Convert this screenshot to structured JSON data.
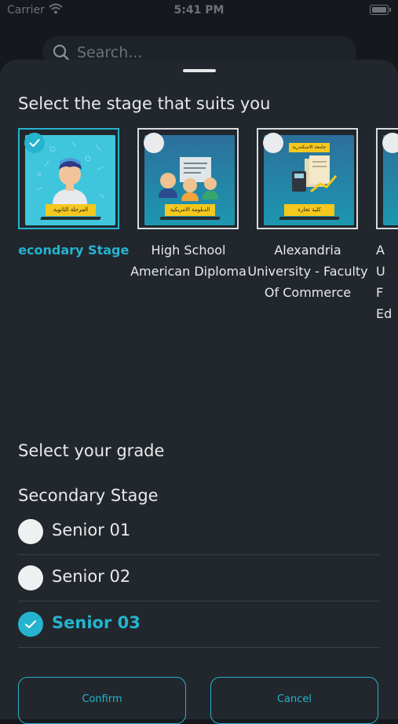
{
  "status_bar": {
    "carrier": "Carrier",
    "time": "5:41 PM"
  },
  "search": {
    "placeholder": "Search..."
  },
  "stage_section": {
    "title": "Select the stage that suits you",
    "stages": [
      {
        "label": "Secondary Stage",
        "thumb_text": "المرحلة الثانوية",
        "selected": true
      },
      {
        "label": "High School American Diploma",
        "thumb_text": "الدبلومة الامريكية",
        "selected": false
      },
      {
        "label": "Alexandria University - Faculty Of Commerce",
        "thumb_text": "كلية تجارة",
        "thumb_header": "جامعة الاسكندرية",
        "selected": false
      },
      {
        "label": "A U F Ed",
        "selected": false
      }
    ]
  },
  "grade_section": {
    "title": "Select your grade",
    "subtitle": "Secondary Stage",
    "grades": [
      {
        "label": "Senior 01",
        "selected": false
      },
      {
        "label": "Senior 02",
        "selected": false
      },
      {
        "label": "Senior 03",
        "selected": true
      }
    ]
  },
  "actions": {
    "confirm": "Confirm",
    "cancel": "Cancel"
  },
  "colors": {
    "accent": "#25b3cf",
    "sheet": "#21272c",
    "background": "#15191d"
  }
}
